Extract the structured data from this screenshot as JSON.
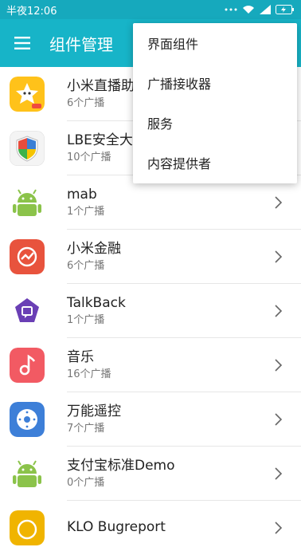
{
  "status": {
    "time": "半夜12:06",
    "icons": [
      "more-dots-icon",
      "wifi-icon",
      "cellular-signal-icon",
      "battery-charging-icon"
    ]
  },
  "appbar": {
    "title": "组件管理",
    "menu_icon": "hamburger-menu-icon"
  },
  "colors": {
    "status_bg": "#16a9bd",
    "appbar_bg": "#17b4c8"
  },
  "apps": [
    {
      "name": "小米直播助手",
      "count": "6个广播",
      "icon": "xiaomi-live-icon"
    },
    {
      "name": "LBE安全大师",
      "count": "10个广播",
      "icon": "lbe-shield-icon"
    },
    {
      "name": "mab",
      "count": "1个广播",
      "icon": "android-icon"
    },
    {
      "name": "小米金融",
      "count": "6个广播",
      "icon": "xiaomi-finance-icon"
    },
    {
      "name": "TalkBack",
      "count": "1个广播",
      "icon": "talkback-icon"
    },
    {
      "name": "音乐",
      "count": "16个广播",
      "icon": "music-icon"
    },
    {
      "name": "万能遥控",
      "count": "7个广播",
      "icon": "remote-control-icon"
    },
    {
      "name": "支付宝标准Demo",
      "count": "0个广播",
      "icon": "android-icon"
    },
    {
      "name": "KLO Bugreport",
      "count": "",
      "icon": "klo-bugreport-icon"
    }
  ],
  "menu": {
    "items": [
      "界面组件",
      "广播接收器",
      "服务",
      "内容提供者"
    ]
  }
}
